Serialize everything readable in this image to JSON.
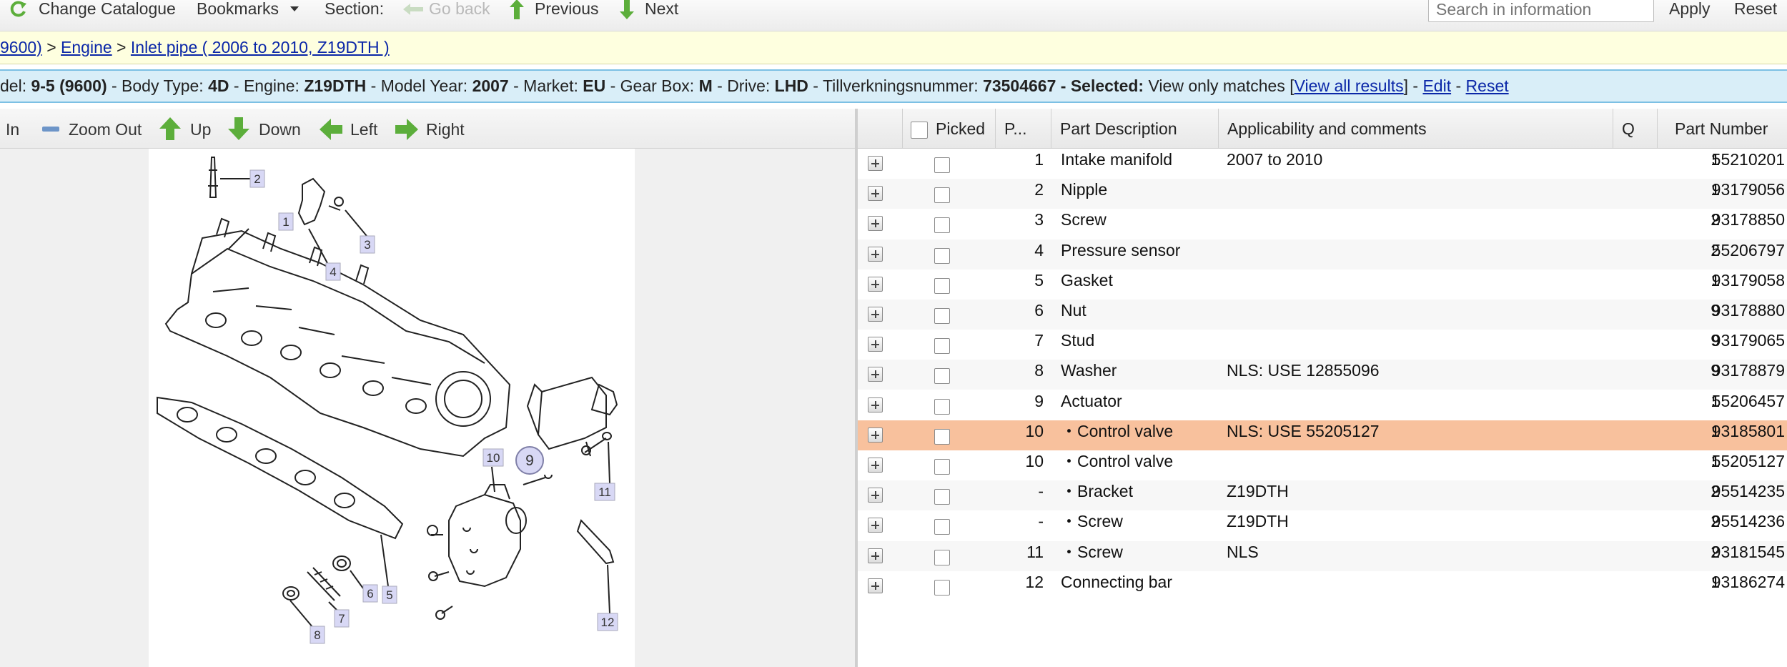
{
  "toolbar": {
    "change_catalogue": "Change Catalogue",
    "bookmarks": "Bookmarks",
    "section": "Section:",
    "go_back": "Go back",
    "previous": "Previous",
    "next": "Next",
    "search_placeholder": "Search in information",
    "apply": "Apply",
    "reset": "Reset"
  },
  "breadcrumb": {
    "model_fragment": "9600)",
    "sep1": " > ",
    "engine": "Engine",
    "sep2": " > ",
    "current": "Inlet pipe ( 2006 to 2010, Z19DTH )"
  },
  "info": {
    "model_label": "del: ",
    "model_value": "9-5 (9600)",
    "body_label": " - Body Type: ",
    "body_value": "4D",
    "engine_label": " - Engine: ",
    "engine_value": "Z19DTH",
    "year_label": " - Model Year: ",
    "year_value": "2007",
    "market_label": " - Market: ",
    "market_value": "EU",
    "gearbox_label": " - Gear Box: ",
    "gearbox_value": "M",
    "drive_label": " - Drive: ",
    "drive_value": "LHD",
    "serial_label": " - Tillverkningsnummer: ",
    "serial_value": "73504667",
    "selected_label": " - Selected:",
    "selected_value": " View only matches [",
    "view_all": "View all results",
    "bracket_close": "] - ",
    "edit": "Edit",
    "dash": " - ",
    "reset": "Reset"
  },
  "zoom": {
    "zoom_in": "In",
    "zoom_out": "Zoom Out",
    "up": "Up",
    "down": "Down",
    "left": "Left",
    "right": "Right"
  },
  "diagram": {
    "callouts": [
      "2",
      "1",
      "3",
      "4",
      "5",
      "6",
      "7",
      "8",
      "9",
      "10",
      "11",
      "12"
    ]
  },
  "table": {
    "headers": {
      "picked": "Picked",
      "position": "P...",
      "description": "Part Description",
      "applicability": "Applicability and comments",
      "quantity": "Q",
      "part_number": "Part Number"
    },
    "rows": [
      {
        "pos": "1",
        "desc": "Intake manifold",
        "app": "2007 to 2010",
        "qty": "1",
        "pn": "55210201"
      },
      {
        "pos": "2",
        "desc": "Nipple",
        "app": "",
        "qty": "1",
        "pn": "93179056"
      },
      {
        "pos": "3",
        "desc": "Screw",
        "app": "",
        "qty": "2",
        "pn": "93178850"
      },
      {
        "pos": "4",
        "desc": "Pressure sensor",
        "app": "",
        "qty": "2",
        "pn": "55206797"
      },
      {
        "pos": "5",
        "desc": "Gasket",
        "app": "",
        "qty": "1",
        "pn": "93179058"
      },
      {
        "pos": "6",
        "desc": "Nut",
        "app": "",
        "qty": "9",
        "pn": "93178880"
      },
      {
        "pos": "7",
        "desc": "Stud",
        "app": "",
        "qty": "9",
        "pn": "93179065"
      },
      {
        "pos": "8",
        "desc": "Washer",
        "app": "NLS: USE 12855096",
        "qty": "9",
        "pn": "93178879"
      },
      {
        "pos": "9",
        "desc": "Actuator",
        "app": "",
        "qty": "1",
        "pn": "55206457"
      },
      {
        "pos": "10",
        "desc": "・Control valve",
        "app": "NLS: USE 55205127",
        "qty": "1",
        "pn": "93185801"
      },
      {
        "pos": "10",
        "desc": "・Control valve",
        "app": "",
        "qty": "1",
        "pn": "55205127"
      },
      {
        "pos": "-",
        "desc": "・Bracket",
        "app": "Z19DTH",
        "qty": "2",
        "pn": "95514235"
      },
      {
        "pos": "-",
        "desc": "・Screw",
        "app": "Z19DTH",
        "qty": "2",
        "pn": "95514236"
      },
      {
        "pos": "11",
        "desc": "・Screw",
        "app": "NLS",
        "qty": "2",
        "pn": "93181545"
      },
      {
        "pos": "12",
        "desc": "Connecting bar",
        "app": "",
        "qty": "1",
        "pn": "93186274"
      }
    ],
    "selected_row": 9
  },
  "colors": {
    "breadcrumb_bg": "#feffdf",
    "infobar_bg": "#d9eef8",
    "link": "#0b27a8",
    "selected_row": "#f8c19d",
    "arrow_green": "#5cae3b"
  }
}
